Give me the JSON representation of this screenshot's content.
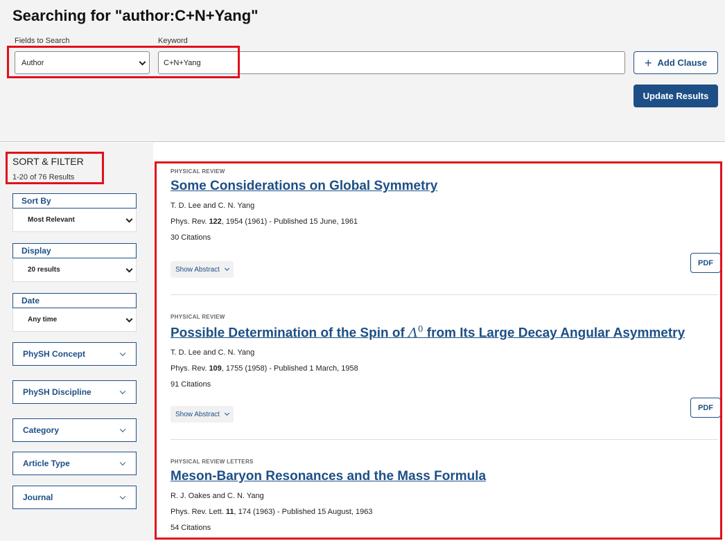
{
  "header": {
    "title": "Searching for \"author:C+N+Yang\"",
    "fields_label": "Fields to Search",
    "keyword_label": "Keyword",
    "field_value": "Author",
    "keyword_value": "C+N+Yang",
    "add_clause_label": "Add Clause",
    "update_label": "Update Results"
  },
  "sidebar": {
    "title": "SORT & FILTER",
    "count": "1-20 of 76 Results",
    "sort": {
      "label": "Sort By",
      "value": "Most Relevant"
    },
    "display": {
      "label": "Display",
      "value": "20 results"
    },
    "date": {
      "label": "Date",
      "value": "Any time"
    },
    "accordions": [
      "PhySH Concept",
      "PhySH Discipline",
      "Category",
      "Article Type",
      "Journal"
    ]
  },
  "results": [
    {
      "journal": "PHYSICAL REVIEW",
      "title": "Some Considerations on Global Symmetry",
      "authors": "T. D. Lee and C. N. Yang",
      "cite_prefix": "Phys. Rev. ",
      "volume": "122",
      "cite_suffix": ", 1954 (1961) - Published 15 June, 1961",
      "citations": "30 Citations",
      "show_abstract": "Show Abstract",
      "pdf": "PDF"
    },
    {
      "journal": "PHYSICAL REVIEW",
      "title_pre": "Possible Determination of the Spin of ",
      "title_symbol": "Λ",
      "title_sup": "0",
      "title_post": " from Its Large Decay Angular Asymmetry",
      "authors": "T. D. Lee and C. N. Yang",
      "cite_prefix": "Phys. Rev. ",
      "volume": "109",
      "cite_suffix": ", 1755 (1958) - Published 1 March, 1958",
      "citations": "91 Citations",
      "show_abstract": "Show Abstract",
      "pdf": "PDF"
    },
    {
      "journal": "PHYSICAL REVIEW LETTERS",
      "title": "Meson-Baryon Resonances and the Mass Formula",
      "authors": "R. J. Oakes and C. N. Yang",
      "cite_prefix": "Phys. Rev. Lett. ",
      "volume": "11",
      "cite_suffix": ", 174 (1963) - Published 15 August, 1963",
      "citations": "54 Citations"
    }
  ],
  "colors": {
    "accent": "#1d4f86",
    "highlight": "#e0101a",
    "panel_bg": "#f3f3f3"
  }
}
